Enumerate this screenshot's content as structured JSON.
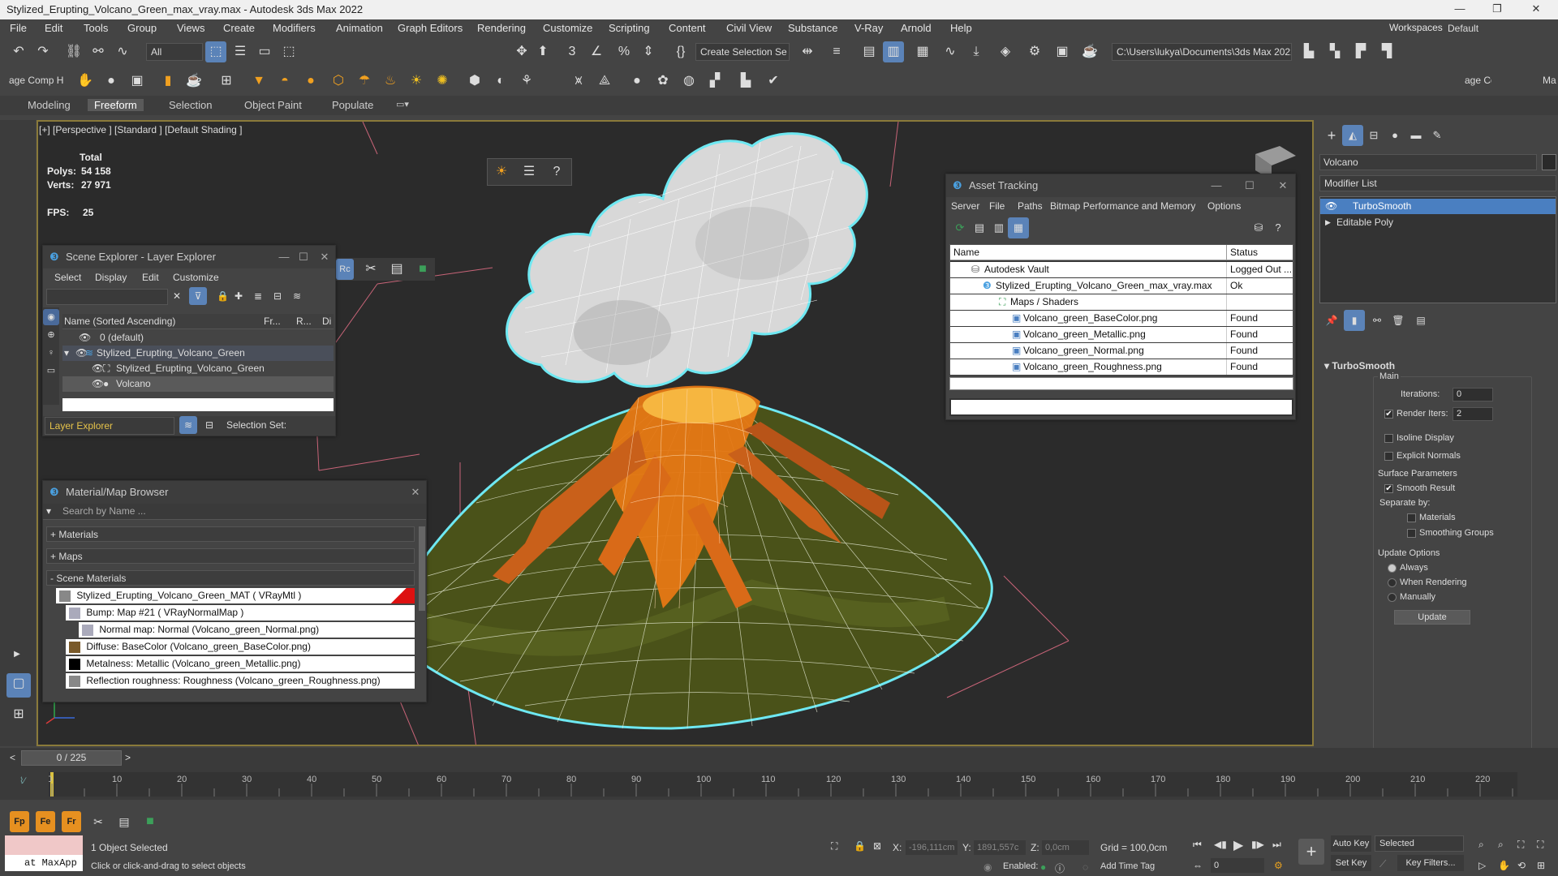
{
  "window": {
    "title": "Stylized_Erupting_Volcano_Green_max_vray.max - Autodesk 3ds Max 2022",
    "min": "—",
    "max": "❐",
    "close": "✕"
  },
  "menu": [
    "File",
    "Edit",
    "Tools",
    "Group",
    "Views",
    "Create",
    "Modifiers",
    "Animation",
    "Graph Editors",
    "Rendering",
    "Customize",
    "Scripting",
    "Content",
    "Civil View",
    "Substance",
    "V-Ray",
    "Arnold",
    "Help"
  ],
  "workspace": {
    "label": "Workspaces:",
    "value": "Default"
  },
  "toolbar": {
    "filter": "All",
    "selection_set": "Create Selection Se",
    "path": "C:\\Users\\lukya\\Documents\\3ds Max 2022",
    "left_tool": "age Comp Hel",
    "right_tool": "age Cc",
    "far_right": "Ma"
  },
  "ribbon": [
    "Modeling",
    "Freeform",
    "Selection",
    "Object Paint",
    "Populate"
  ],
  "viewport": {
    "label": "[+] [Perspective ] [Standard ] [Default Shading ]",
    "stats_total": "Total",
    "polys_label": "Polys:",
    "polys": "54 158",
    "verts_label": "Verts:",
    "verts": "27 971",
    "fps_label": "FPS:",
    "fps": "25"
  },
  "scene_explorer": {
    "title": "Scene Explorer - Layer Explorer",
    "menu": [
      "Select",
      "Display",
      "Edit",
      "Customize"
    ],
    "col_name": "Name (Sorted Ascending)",
    "col_fr": "Fr...",
    "col_r": "R...",
    "col_d": "Di",
    "rows": [
      "0 (default)",
      "Stylized_Erupting_Volcano_Green",
      "Stylized_Erupting_Volcano_Green",
      "Volcano"
    ],
    "footer_left": "Layer Explorer",
    "footer_right": "Selection Set:"
  },
  "material_browser": {
    "title": "Material/Map Browser",
    "search": "Search by Name ...",
    "sections": [
      "+ Materials",
      "+ Maps",
      "- Scene Materials"
    ],
    "items": [
      "Stylized_Erupting_Volcano_Green_MAT ( VRayMtl )",
      "Bump: Map #21 ( VRayNormalMap )",
      "Normal map: Normal (Volcano_green_Normal.png)",
      "Diffuse: BaseColor (Volcano_green_BaseColor.png)",
      "Metalness: Metallic (Volcano_green_Metallic.png)",
      "Reflection roughness: Roughness (Volcano_green_Roughness.png)"
    ]
  },
  "asset_tracking": {
    "title": "Asset Tracking",
    "menu": [
      "Server",
      "File",
      "Paths",
      "Bitmap Performance and Memory",
      "Options"
    ],
    "col_name": "Name",
    "col_status": "Status",
    "rows": [
      {
        "name": "Autodesk Vault",
        "status": "Logged Out ..."
      },
      {
        "name": "Stylized_Erupting_Volcano_Green_max_vray.max",
        "status": "Ok"
      },
      {
        "name": "Maps / Shaders",
        "status": ""
      },
      {
        "name": "Volcano_green_BaseColor.png",
        "status": "Found"
      },
      {
        "name": "Volcano_green_Metallic.png",
        "status": "Found"
      },
      {
        "name": "Volcano_green_Normal.png",
        "status": "Found"
      },
      {
        "name": "Volcano_green_Roughness.png",
        "status": "Found"
      }
    ]
  },
  "command_panel": {
    "object_name": "Volcano",
    "modifier_list": "Modifier List",
    "stack": [
      "TurboSmooth",
      "Editable Poly"
    ],
    "rollout": "TurboSmooth",
    "main": "Main",
    "iterations_label": "Iterations:",
    "iterations": "0",
    "render_iters_label": "Render Iters:",
    "render_iters": "2",
    "isoline": "Isoline Display",
    "explicit": "Explicit Normals",
    "surface": "Surface Parameters",
    "smooth": "Smooth Result",
    "separate": "Separate by:",
    "materials": "Materials",
    "smoothing": "Smoothing Groups",
    "update_opts": "Update Options",
    "always": "Always",
    "when_rendering": "When Rendering",
    "manually": "Manually",
    "update_btn": "Update"
  },
  "timeline": {
    "frame": "0 / 225",
    "ticks": [
      "0",
      "10",
      "20",
      "30",
      "40",
      "50",
      "60",
      "70",
      "80",
      "90",
      "100",
      "110",
      "120",
      "130",
      "140",
      "150",
      "160",
      "170",
      "180",
      "190",
      "200",
      "210",
      "220"
    ]
  },
  "status": {
    "maxscript": "at MaxApp",
    "selected": "1 Object Selected",
    "hint": "Click or click-and-drag to select objects",
    "x_label": "X:",
    "x": "-196,111cm",
    "y_label": "Y:",
    "y": "1891,557c",
    "z_label": "Z:",
    "z": "0,0cm",
    "grid": "Grid = 100,0cm",
    "enabled": "Enabled:",
    "add_time_tag": "Add Time Tag",
    "auto_key": "Auto Key",
    "set_key": "Set Key",
    "key_mode": "Selected",
    "key_filters": "Key Filters...",
    "frame_field": "0"
  },
  "colors": {
    "accent": "#4a7fc1",
    "viewport_border": "#8a7a3a",
    "wire_highlight": "#66e6f0"
  }
}
